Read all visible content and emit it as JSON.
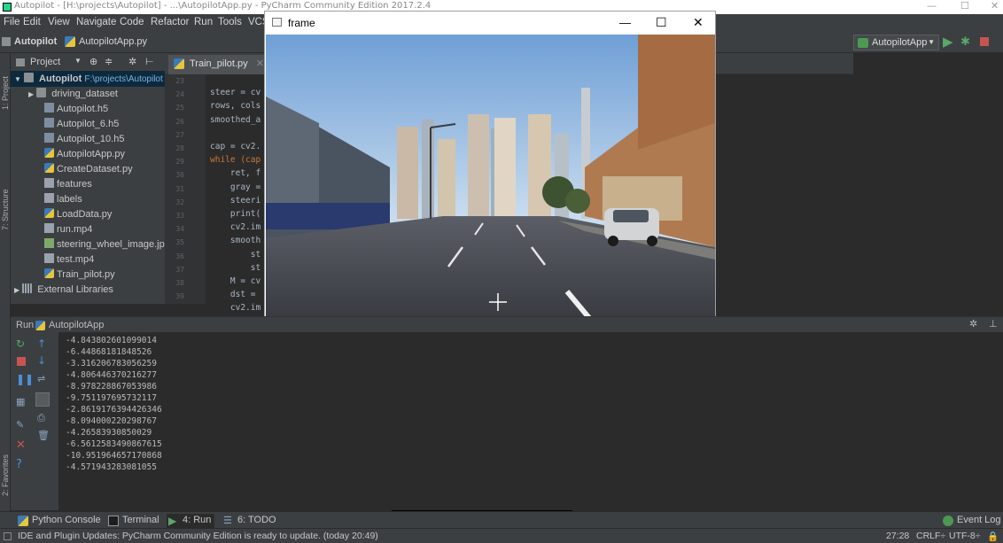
{
  "window": {
    "title": "Autopilot - [H:\\projects\\Autopilot] - ...\\AutopilotApp.py - PyCharm Community Edition 2017.2.4",
    "min": "—",
    "max": "☐",
    "close": "✕"
  },
  "menu": [
    "File",
    "Edit",
    "View",
    "Navigate",
    "Code",
    "Refactor",
    "Run",
    "Tools",
    "VCS"
  ],
  "nav": {
    "project": "Autopilot",
    "file": "AutopilotApp.py",
    "run_config": "AutopilotApp"
  },
  "left_strip": {
    "project_tab": "1: Project",
    "structure_tab": "7: Structure",
    "favorites_tab": "2: Favorites"
  },
  "project_panel": {
    "header": "Project",
    "root_name": "Autopilot",
    "root_path": "F:\\projects\\Autopilot",
    "items": [
      {
        "label": "driving_dataset",
        "icon": "folder-icon",
        "type": "folder"
      },
      {
        "label": "Autopilot.h5",
        "icon": "h5-file-icon",
        "type": "h5"
      },
      {
        "label": "Autopilot_6.h5",
        "icon": "h5-file-icon",
        "type": "h5"
      },
      {
        "label": "Autopilot_10.h5",
        "icon": "h5-file-icon",
        "type": "h5"
      },
      {
        "label": "AutopilotApp.py",
        "icon": "python-file-icon",
        "type": "py"
      },
      {
        "label": "CreateDataset.py",
        "icon": "python-file-icon",
        "type": "py"
      },
      {
        "label": "features",
        "icon": "file-icon",
        "type": "file"
      },
      {
        "label": "labels",
        "icon": "file-icon",
        "type": "file"
      },
      {
        "label": "LoadData.py",
        "icon": "python-file-icon",
        "type": "py"
      },
      {
        "label": "run.mp4",
        "icon": "file-icon",
        "type": "file"
      },
      {
        "label": "steering_wheel_image.jpg",
        "icon": "image-file-icon",
        "type": "jpg"
      },
      {
        "label": "test.mp4",
        "icon": "file-icon",
        "type": "file"
      },
      {
        "label": "Train_pilot.py",
        "icon": "python-file-icon",
        "type": "py"
      }
    ],
    "external": "External Libraries"
  },
  "editor": {
    "tab": "Train_pilot.py",
    "line_numbers": [
      "23",
      "24",
      "25",
      "26",
      "27",
      "28",
      "29",
      "30",
      "31",
      "32",
      "33",
      "34",
      "35",
      "36",
      "37",
      "38",
      "39"
    ],
    "lines": [
      "",
      "steer = cv",
      "rows, cols",
      "smoothed_a",
      "",
      "cap = cv2.",
      "while (cap",
      "    ret, f",
      "    gray =",
      "    steeri",
      "    print(",
      "    cv2.im",
      "    smooth",
      "        st",
      "        st",
      "    M = cv",
      "    dst =",
      "    cv2.im"
    ]
  },
  "frame_window": {
    "title": "frame",
    "min": "—",
    "max": "☐",
    "close": "✕"
  },
  "run_panel": {
    "label": "Run",
    "config": "AutopilotApp",
    "output": [
      "-4.843802601099014",
      "-6.44868181848526",
      "-3.316206783056259",
      "-4.806446370216277",
      "-8.978228867053986",
      "-9.751197695732117",
      "-2.8619176394426346",
      "-8.094000220298767",
      "-4.26583930850029",
      "-6.5612583490867615",
      "-10.951964657170868",
      "-4.571943283081055"
    ]
  },
  "bottom_tools": {
    "python_console": "Python Console",
    "terminal": "Terminal",
    "run": "4: Run",
    "todo": "6: TODO",
    "event_log": "Event Log"
  },
  "status": {
    "message": "IDE and Plugin Updates: PyCharm Community Edition is ready to update. (today 20:49)",
    "position": "27:28",
    "line_sep": "CRLF÷",
    "encoding": "UTF-8÷"
  },
  "colors": {
    "background": "#2b2b2b",
    "panel": "#3c3f41",
    "selection": "#0d293e",
    "run_green": "#59a869",
    "stop_red": "#c75450",
    "keyword": "#cc7832"
  }
}
